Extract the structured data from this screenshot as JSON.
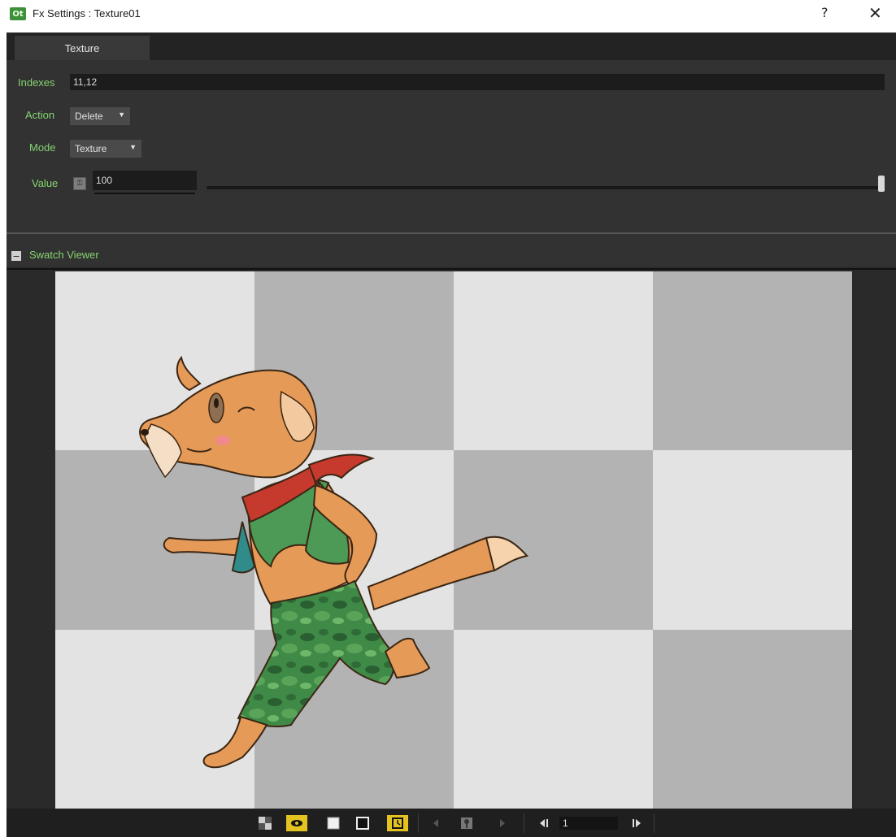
{
  "window": {
    "title": "Fx Settings : Texture01",
    "app_icon_text": "Ot",
    "help_label": "?",
    "close_label": "✕"
  },
  "tabs": [
    {
      "label": "Texture"
    }
  ],
  "settings": {
    "indexes": {
      "label": "Indexes",
      "value": "11,12"
    },
    "action": {
      "label": "Action",
      "value": "Delete"
    },
    "mode": {
      "label": "Mode",
      "value": "Texture"
    },
    "value": {
      "label": "Value",
      "value": "100",
      "slider_fraction": 1.0
    }
  },
  "swatch_viewer": {
    "title": "Swatch Viewer",
    "collapse_label": "−"
  },
  "bottom_toolbar": {
    "frame_value": "1",
    "tools": [
      "checkerboard-icon",
      "eye-icon",
      "white-bg-icon",
      "black-bg-icon",
      "clock-icon",
      "prev-arrow-icon",
      "key-icon",
      "next-arrow-icon",
      "first-frame-icon",
      "last-frame-icon"
    ]
  },
  "colors": {
    "accent_green": "#86d36f",
    "highlight_yellow": "#e4c320",
    "checker_light": "#e3e3e3",
    "checker_dark": "#b3b3b3"
  }
}
